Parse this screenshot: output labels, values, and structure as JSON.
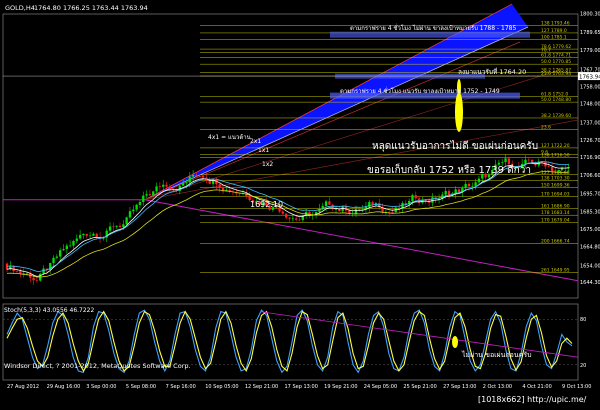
{
  "header": {
    "symbol": "GOLD,H4",
    "ohlc": "1764.80 1766.25 1763.44 1763.94"
  },
  "indicator": {
    "label": "Stoch(5,3,3) 43.0556 46.7222",
    "levels": [
      80,
      20
    ],
    "comment": "ไม่ผ่าน  ขอเผ่นก่อนครับ"
  },
  "annotations": {
    "top_note": "ตามกราฟราย 4 ชั่วโมง ไม่ผ่าน ขาลงเป้าหมายรับ 1788 - 1785",
    "support_note": "ลงมาแนวรับที่ 1764.20",
    "lower_note": "ตามกราฟราย 4 ชั่วโมง แนวรับ ขาลงเป้าหมาย 1752 - 1749",
    "main_note": "หลุดแนวรับอาการไม่ดี  ขอเผ่นก่อนครับ",
    "target_note": "ขอรอเก็บกลับ  1752  หรือ 1739  ดีกว่า",
    "level_1692": "1692.10",
    "gann_fan": [
      "4x1 = แนวต้าน",
      "2x1",
      "1x1",
      "1x2"
    ]
  },
  "footer": {
    "copyright": "Windsor Direct, ? 2001-2012, MetaQuotes Software Corp.",
    "watermark": "[1018x662] http://upic.me/"
  },
  "colors": {
    "bull": "#00e000",
    "bear": "#ff2020",
    "ema_white": "#ffffff",
    "ema_cyan": "#40c0ff",
    "ema_yellow": "#d8d820",
    "fib": "#c8c800",
    "fan_fill": "#0a14ff",
    "stoch_main": "#40a0ff",
    "stoch_signal": "#ffff40"
  },
  "chart_data": [
    {
      "type": "candlestick",
      "symbol": "GOLD",
      "timeframe": "H4",
      "ylim": [
        1635,
        1800
      ],
      "y_ticks": [
        1800.3,
        1789.65,
        1779.0,
        1767.7,
        1758.0,
        1748.0,
        1737.0,
        1726.7,
        1716.9,
        1706.6,
        1695.7,
        1685.3,
        1675.0,
        1664.8,
        1654.0,
        1644.3
      ],
      "y_tick_labels": [
        "1800.30",
        "1789.65",
        "1779.00",
        "1767.70",
        "1758.00",
        "1748.00",
        "1737.00",
        "1726.70",
        "1716.90",
        "1706.60",
        "1695.70",
        "1685.30",
        "1675.00",
        "1664.80",
        "1654.00",
        "1644.30"
      ],
      "x_tick_labels": [
        "27 Aug 2012",
        "29 Aug 16:00",
        "3 Sep 00:00",
        "5 Sep 08:00",
        "7 Sep 16:00",
        "10 Sep 05:00",
        "12 Sep 21:00",
        "17 Sep 13:00",
        "19 Sep 21:00",
        "24 Sep 05:00",
        "25 Sep 21:00",
        "27 Sep 13:00",
        "2 Oct 13:00",
        "4 Oct 21:00",
        "9 Oct 13:00"
      ],
      "current_price": 1763.94,
      "current_price_label": "1763.94",
      "horizontal_levels": [
        1764.2,
        1752,
        1739
      ],
      "fib_levels": [
        {
          "ratio": "138",
          "price": 1793.46,
          "label": "138  1793.46"
        },
        {
          "ratio": "127",
          "price": 1789.0,
          "label": "127  1789.0"
        },
        {
          "ratio": "100",
          "price": 1785.1,
          "label": "100  1785.1"
        },
        {
          "ratio": "78.6",
          "price": 1779.62,
          "label": "78.6  1779.62"
        },
        {
          "ratio": "70.7",
          "price": 1777.7,
          "label": "70.7"
        },
        {
          "ratio": "61.8",
          "price": 1774.71,
          "label": "61.8  1774.71"
        },
        {
          "ratio": "50.0",
          "price": 1770.85,
          "label": "50.0  1770.85"
        },
        {
          "ratio": "38.2",
          "price": 1765.87,
          "label": "38.2  1765.87"
        },
        {
          "ratio": "23.6",
          "price": 1763.94,
          "label": "23.6  1763.94"
        },
        {
          "ratio": "61.8",
          "price": 1752.0,
          "label": "61.8  1752.0"
        },
        {
          "ratio": "50.0",
          "price": 1748.8,
          "label": "50.0  1748.80"
        },
        {
          "ratio": "38.2",
          "price": 1739.6,
          "label": "38.2  1739.60"
        },
        {
          "ratio": "23.6",
          "price": 1733.0,
          "label": "23.6"
        },
        {
          "ratio": "127",
          "price": 1722.2,
          "label": "127  1722.20"
        },
        {
          "ratio": "9.6",
          "price": 1718.5,
          "label": "9.6"
        },
        {
          "ratio": "138",
          "price": 1716.5,
          "label": "138  1716.50"
        },
        {
          "ratio": "127",
          "price": 1706.6,
          "label": "127  1706.60"
        },
        {
          "ratio": "138",
          "price": 1703.3,
          "label": "138  1703.30"
        },
        {
          "ratio": "150",
          "price": 1699.1,
          "label": "150  1699.36"
        },
        {
          "ratio": "170",
          "price": 1694.0,
          "label": "170  1694.03"
        },
        {
          "ratio": "161",
          "price": 1686.9,
          "label": "161  1686.90"
        },
        {
          "ratio": "178",
          "price": 1683.1,
          "label": "178  1683.14"
        },
        {
          "ratio": "170",
          "price": 1679.0,
          "label": "170  1679.04"
        },
        {
          "ratio": "200",
          "price": 1666.7,
          "label": "200  1666.74"
        },
        {
          "ratio": "261",
          "price": 1649.9,
          "label": "261  1649.95"
        }
      ],
      "candles": []
    },
    {
      "type": "line",
      "name": "Stoch(5,3,3)",
      "ylim": [
        0,
        100
      ],
      "levels": [
        80,
        20
      ],
      "series": [
        {
          "values": [
            60,
            75,
            88,
            80,
            55,
            30,
            15,
            20,
            45,
            75,
            90,
            85,
            60,
            30,
            12,
            10,
            30,
            70,
            90,
            88,
            65,
            35,
            15,
            10,
            25,
            60,
            88,
            92,
            80,
            50,
            25,
            12,
            25,
            60,
            88,
            90,
            70,
            40,
            18,
            12,
            30,
            68,
            90,
            88,
            60,
            30,
            12,
            15,
            40,
            78,
            92,
            85,
            55,
            25,
            10,
            18,
            50,
            85,
            92,
            78,
            45,
            20,
            12,
            30,
            70,
            90,
            85,
            50,
            20,
            10,
            25,
            60,
            85,
            90,
            70,
            35,
            15,
            12,
            30,
            65,
            88,
            92,
            75,
            40,
            18,
            12,
            35,
            70,
            90,
            85,
            55,
            25,
            12,
            20,
            50,
            80,
            90,
            75,
            40,
            15,
            12,
            35,
            70,
            88,
            78,
            45,
            20,
            15,
            35,
            60,
            50,
            45
          ]
        },
        {
          "values": [
            55,
            68,
            80,
            82,
            68,
            45,
            25,
            18,
            30,
            58,
            80,
            88,
            75,
            48,
            25,
            12,
            22,
            52,
            80,
            90,
            78,
            50,
            25,
            12,
            18,
            45,
            75,
            90,
            86,
            65,
            38,
            18,
            18,
            45,
            75,
            90,
            80,
            55,
            30,
            15,
            22,
            50,
            80,
            90,
            75,
            45,
            22,
            12,
            28,
            62,
            85,
            90,
            70,
            40,
            18,
            12,
            35,
            70,
            90,
            86,
            60,
            32,
            15,
            20,
            52,
            82,
            88,
            68,
            35,
            15,
            18,
            45,
            75,
            88,
            80,
            52,
            25,
            12,
            20,
            50,
            78,
            90,
            85,
            55,
            28,
            14,
            25,
            55,
            82,
            88,
            70,
            40,
            18,
            15,
            35,
            68,
            86,
            84,
            58,
            28,
            13,
            24,
            55,
            80,
            85,
            62,
            32,
            17,
            25,
            48,
            55,
            48
          ]
        }
      ]
    }
  ]
}
